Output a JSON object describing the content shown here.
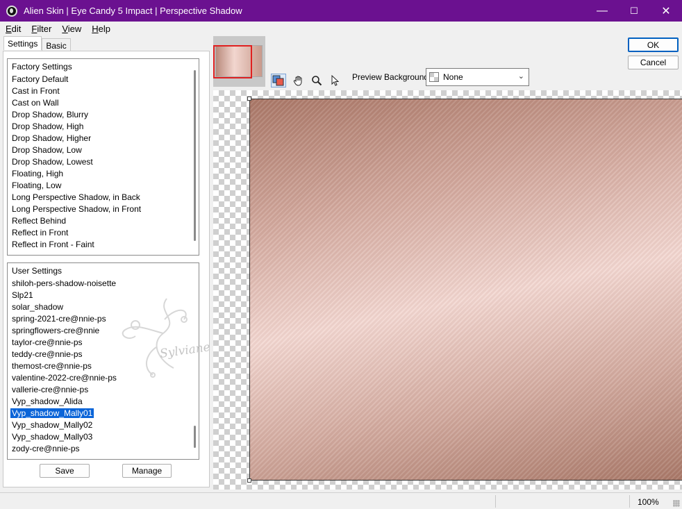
{
  "window": {
    "title": "Alien Skin | Eye Candy 5 Impact | Perspective Shadow",
    "minimize_glyph": "—",
    "maximize_glyph": "☐",
    "close_glyph": "✕"
  },
  "menu": {
    "items": [
      {
        "label": "Edit",
        "mnemonic": "E",
        "rest": "dit"
      },
      {
        "label": "Filter",
        "mnemonic": "F",
        "rest": "ilter"
      },
      {
        "label": "View",
        "mnemonic": "V",
        "rest": "iew"
      },
      {
        "label": "Help",
        "mnemonic": "H",
        "rest": "elp"
      }
    ]
  },
  "tabs": [
    "Settings",
    "Basic"
  ],
  "factory": {
    "header": "Factory Settings",
    "items": [
      "Factory Default",
      "Cast in Front",
      "Cast on Wall",
      "Drop Shadow, Blurry",
      "Drop Shadow, High",
      "Drop Shadow, Higher",
      "Drop Shadow, Low",
      "Drop Shadow, Lowest",
      "Floating, High",
      "Floating, Low",
      "Long Perspective Shadow, in Back",
      "Long Perspective Shadow, in Front",
      "Reflect Behind",
      "Reflect in Front",
      "Reflect in Front - Faint"
    ]
  },
  "user": {
    "header": "User Settings",
    "items": [
      "shiloh-pers-shadow-noisette",
      "Slp21",
      "solar_shadow",
      "spring-2021-cre@nnie-ps",
      "springflowers-cre@nnie",
      "taylor-cre@nnie-ps",
      "teddy-cre@nnie-ps",
      "themost-cre@nnie-ps",
      "valentine-2022-cre@nnie-ps",
      "vallerie-cre@nnie-ps",
      "Vyp_shadow_Alida",
      "Vyp_shadow_Mally01",
      "Vyp_shadow_Mally02",
      "Vyp_shadow_Mally03",
      "zody-cre@nnie-ps"
    ],
    "selected_index": 11
  },
  "buttons": {
    "save": "Save",
    "manage": "Manage",
    "ok": "OK",
    "cancel": "Cancel"
  },
  "preview": {
    "background_label": "Preview Background:",
    "background_value": "None"
  },
  "watermark": "Sylviane",
  "status": {
    "zoom": "100%"
  }
}
